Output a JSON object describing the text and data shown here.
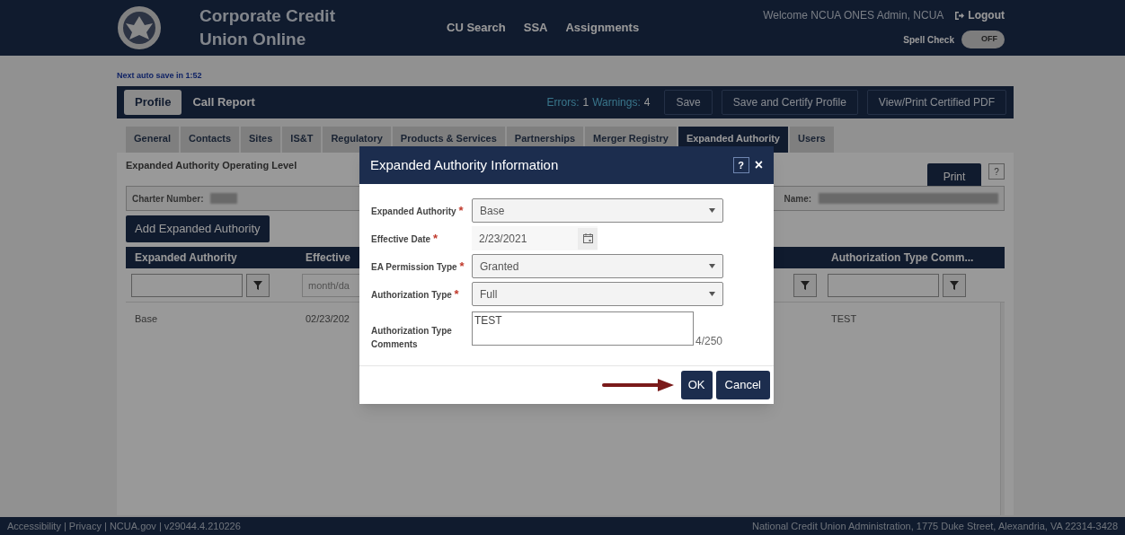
{
  "header": {
    "title_lines": [
      "Corporate Credit",
      "Union Online"
    ],
    "nav": [
      "CU Search",
      "SSA",
      "Assignments"
    ],
    "welcome": "Welcome NCUA ONES Admin, NCUA",
    "logout": "Logout",
    "spell_check": {
      "label": "Spell Check",
      "on": false,
      "state_text": "OFF"
    }
  },
  "autosave": "Next auto save in 1:52",
  "profile_bar": {
    "tabs": [
      {
        "label": "Profile",
        "selected": true
      },
      {
        "label": "Call Report",
        "selected": false
      }
    ],
    "errors_label": "Errors:",
    "errors": "1",
    "warnings_label": "Warnings:",
    "warnings": "4",
    "buttons": [
      "Save",
      "Save and Certify Profile",
      "View/Print Certified PDF"
    ]
  },
  "tabs": [
    {
      "label": "General",
      "selected": false
    },
    {
      "label": "Contacts",
      "selected": false
    },
    {
      "label": "Sites",
      "selected": false
    },
    {
      "label": "IS&T",
      "selected": false
    },
    {
      "label": "Regulatory",
      "selected": false
    },
    {
      "label": "Products & Services",
      "selected": false
    },
    {
      "label": "Partnerships",
      "selected": false
    },
    {
      "label": "Merger Registry",
      "selected": false
    },
    {
      "label": "Expanded Authority",
      "selected": true
    },
    {
      "label": "Users",
      "selected": false
    }
  ],
  "panel": {
    "title": "Expanded Authority Operating Level",
    "print": "Print",
    "help": "?",
    "charter_label": "Charter Number:",
    "name_label": "Name:",
    "add_button": "Add Expanded Authority"
  },
  "table": {
    "columns": [
      {
        "label": "Expanded Authority",
        "filter": {
          "kind": "text"
        }
      },
      {
        "label": "Effective",
        "filter": {
          "kind": "date",
          "placeholder": "month/da"
        }
      },
      {
        "filter": {
          "kind": "button"
        }
      },
      {
        "label": "Authorization Type Comm...",
        "filter": {
          "kind": "text"
        }
      }
    ],
    "rows": [
      {
        "column_1": "Base",
        "column_2": "02/23/202",
        "column_4": "TEST"
      }
    ]
  },
  "dialog": {
    "title": "Expanded Authority Information",
    "help": "?",
    "close": "×",
    "fields": [
      {
        "kind": "select",
        "label": "Expanded Authority",
        "required": true,
        "required_mark": "*",
        "value": "Base"
      },
      {
        "kind": "date",
        "label": "Effective Date",
        "required": true,
        "required_mark": "*",
        "value": "2/23/2021"
      },
      {
        "kind": "select",
        "label": "EA Permission Type",
        "required": true,
        "required_mark": "*",
        "value": "Granted"
      },
      {
        "kind": "select",
        "label": "Authorization Type",
        "required": true,
        "required_mark": "*",
        "value": "Full"
      },
      {
        "kind": "textarea",
        "label": "Authorization Type Comments",
        "required": false,
        "value": "TEST",
        "counter": "4/250"
      }
    ],
    "buttons": [
      {
        "label": "OK",
        "kind": "primary"
      },
      {
        "label": "Cancel",
        "kind": "secondary"
      }
    ]
  },
  "footer": {
    "links": "Accessibility | Privacy | NCUA.gov | v29044.4.210226",
    "address": "National Credit Union Administration, 1775 Duke Street, Alexandria, VA 22314-3428"
  }
}
